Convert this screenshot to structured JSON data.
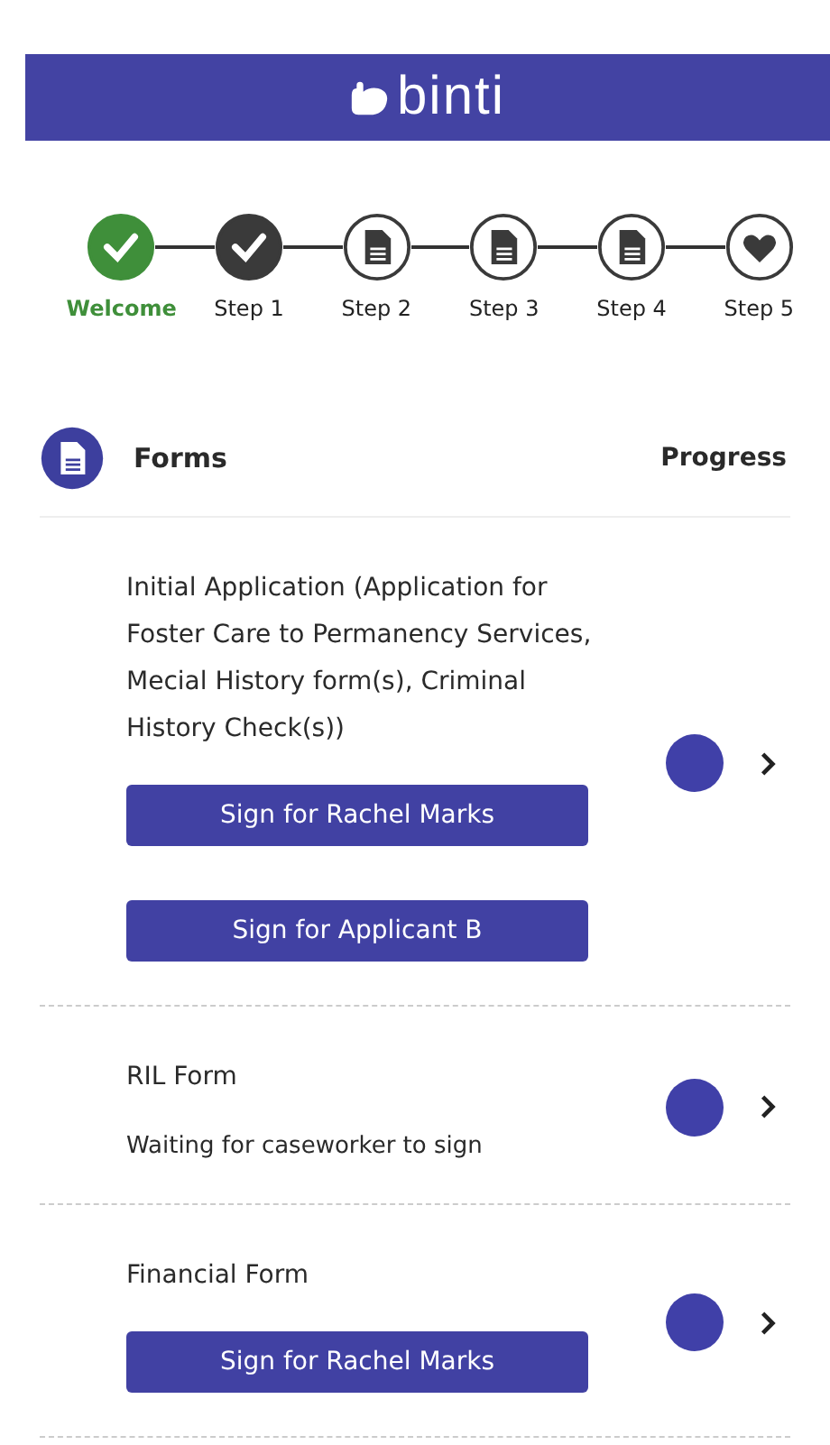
{
  "header": {
    "brand": "binti"
  },
  "steps": [
    {
      "label": "Welcome",
      "done": true,
      "selected": true,
      "kind": "check"
    },
    {
      "label": "Step 1",
      "done": true,
      "selected": false,
      "kind": "check"
    },
    {
      "label": "Step 2",
      "done": false,
      "selected": false,
      "kind": "document"
    },
    {
      "label": "Step 3",
      "done": false,
      "selected": false,
      "kind": "document"
    },
    {
      "label": "Step 4",
      "done": false,
      "selected": false,
      "kind": "document"
    },
    {
      "label": "Step 5",
      "done": false,
      "selected": false,
      "kind": "heart"
    }
  ],
  "forms_section": {
    "title": "Forms",
    "progress_heading": "Progress",
    "forms": [
      {
        "title": "Initial Application (Application for Foster Care to Permanency Services, Mecial History form(s), Criminal History Check(s))",
        "buttons": [
          "Sign for Rachel Marks",
          "Sign for Applicant B"
        ]
      },
      {
        "title": "RIL Form",
        "note": "Waiting for caseworker to sign"
      },
      {
        "title": "Financial Form",
        "buttons": [
          "Sign for Rachel Marks"
        ]
      }
    ]
  }
}
